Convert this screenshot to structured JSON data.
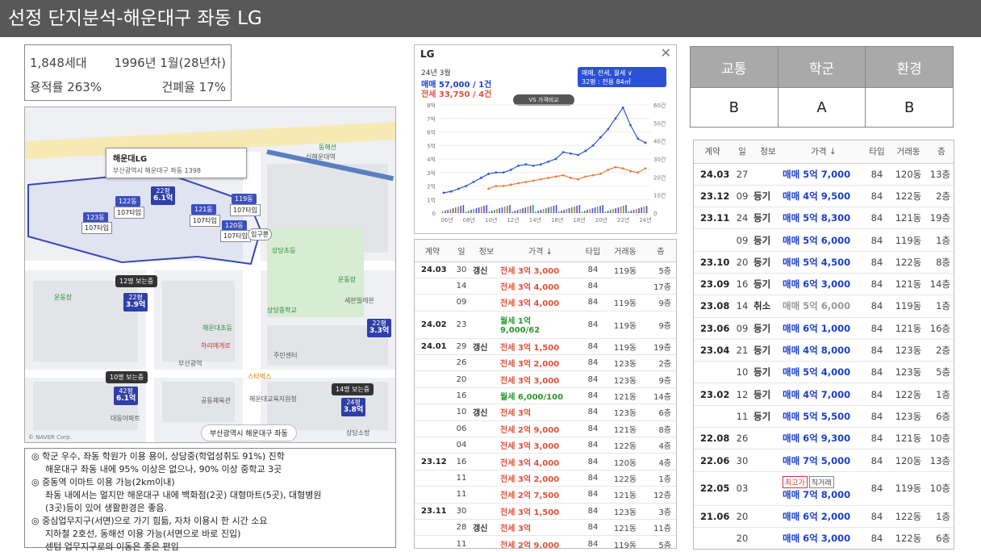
{
  "title": "선정 단지분석-해운대구 좌동 LG",
  "info": {
    "households": "1,848세대",
    "built": "1996년 1월(28년차)",
    "far": "용적률 263%",
    "bcr": "건폐율 17%"
  },
  "map": {
    "popup_name": "해운대LG",
    "popup_addr": "부산광역시 해운대구 좌동 1398",
    "address_bar": "부산광역시 해운대구 좌동",
    "credit": "© NAVER Corp.",
    "station": "신해운대역",
    "entrance": "입구뿐",
    "pins": [
      {
        "label": "22평",
        "price": "6.1억"
      },
      {
        "label": "22평",
        "price": "3.9억"
      },
      {
        "label": "22평",
        "price": "3.3억"
      },
      {
        "label": "42평",
        "price": "6.1억"
      },
      {
        "label": "24평",
        "price": "3.8억"
      }
    ],
    "buildings": [
      {
        "dong": "122동",
        "type": "107타입"
      },
      {
        "dong": "123동",
        "type": "107타입"
      },
      {
        "dong": "121동",
        "type": "107타입"
      },
      {
        "dong": "119동",
        "type": "107타입"
      },
      {
        "dong": "120동",
        "type": "107타입"
      }
    ],
    "floor_tags": [
      "12명 보는중",
      "10명 보는중",
      "14명 보는중"
    ],
    "places": [
      "상당초등",
      "상당중학교",
      "운동장",
      "하리에게로",
      "해운대초등",
      "부산광역",
      "스타벅스",
      "공동체육관",
      "해운대교육지원청",
      "대동아파트",
      "주민센터",
      "세븐일레븐",
      "상당소방",
      "동해선"
    ]
  },
  "notes": [
    "◎ 학군 우수, 좌동 학원가 이용 용이, 상당중(학업성취도 91%) 진학",
    "해운대구 좌동 내에 95% 이상은 없으나, 90% 이상 중학교 3곳",
    "◎ 중동역 이마트 이용 가능(2km이내)",
    "좌동 내에서는 멀지만 해운대구 내에 백화점(2곳) 대형마트(5곳), 대형병원",
    "(3곳)등이 있어 생활환경은 좋음.",
    "◎ 중심업무지구(서면)으로 가기 힘듦, 자차 이용시 한 시간 소요",
    "지하철 2호선, 동해선 이용 가능(서면으로 바로 진입)",
    "센텀 업무지구로의 이동은 좋은 편임"
  ],
  "chart_panel": {
    "title": "LG",
    "period": "24년 3월",
    "sale_summary": "매매 57,000 / 1건",
    "rent_summary": "전세 33,750 / 4건",
    "filter_line1": "매매, 전세, 월세 ∨",
    "filter_line2": "32평 : 전용 84㎡",
    "compare_button": "VS 가격비교"
  },
  "chart_data": {
    "type": "line",
    "x": [
      "06년",
      "08년",
      "10년",
      "12년",
      "14년",
      "16년",
      "18년",
      "20년",
      "22년",
      "24년"
    ],
    "y_left_ticks": [
      "0",
      "1억",
      "2억",
      "3억",
      "4억",
      "5억",
      "6억",
      "7억",
      "8억"
    ],
    "y_right_ticks": [
      "0",
      "10건",
      "20건",
      "30건",
      "40건",
      "50건",
      "60건"
    ],
    "ylim": [
      0,
      8
    ],
    "series": [
      {
        "name": "매매",
        "color": "#2a5ad8",
        "values": [
          1.5,
          1.6,
          1.8,
          2.0,
          2.3,
          2.6,
          2.9,
          3.0,
          3.0,
          3.2,
          3.5,
          3.6,
          3.5,
          3.6,
          3.8,
          4.0,
          4.5,
          4.4,
          4.3,
          4.6,
          5.0,
          5.6,
          6.2,
          7.0,
          7.8,
          6.5,
          5.5,
          5.2
        ]
      },
      {
        "name": "전세",
        "color": "#f07a3a",
        "values": [
          null,
          null,
          null,
          null,
          null,
          null,
          1.8,
          2.0,
          2.0,
          2.1,
          2.2,
          2.3,
          2.4,
          2.5,
          2.6,
          2.7,
          2.8,
          2.6,
          2.5,
          2.7,
          2.8,
          2.9,
          3.2,
          3.4,
          3.3,
          3.1,
          3.0,
          3.3
        ]
      }
    ],
    "grid": true
  },
  "mid_table": {
    "headers": [
      "계약",
      "일",
      "정보",
      "가격 ↓",
      "타입",
      "거래동",
      "층"
    ],
    "rows": [
      {
        "date": "24.03",
        "day": "30",
        "info": "갱신",
        "price": "전세 3억 3,000",
        "type": "84",
        "dong": "119동",
        "floor": "5층",
        "kind": "jeonse"
      },
      {
        "date": "",
        "day": "14",
        "info": "",
        "price": "전세 3억 4,000",
        "type": "84",
        "dong": "",
        "floor": "17층",
        "kind": "jeonse"
      },
      {
        "date": "",
        "day": "09",
        "info": "",
        "price": "전세 3억 4,000",
        "type": "84",
        "dong": "119동",
        "floor": "9층",
        "kind": "jeonse"
      },
      {
        "date": "24.02",
        "day": "23",
        "info": "",
        "price": "월세 1억",
        "price2": "9,000/62",
        "type": "84",
        "dong": "119동",
        "floor": "9층",
        "kind": "wolse"
      },
      {
        "date": "24.01",
        "day": "29",
        "info": "갱신",
        "price": "전세 3억 1,500",
        "type": "84",
        "dong": "119동",
        "floor": "19층",
        "kind": "jeonse"
      },
      {
        "date": "",
        "day": "26",
        "info": "",
        "price": "전세 3억 2,000",
        "type": "84",
        "dong": "123동",
        "floor": "2층",
        "kind": "jeonse"
      },
      {
        "date": "",
        "day": "20",
        "info": "",
        "price": "전세 3억 3,000",
        "type": "84",
        "dong": "123동",
        "floor": "9층",
        "kind": "jeonse"
      },
      {
        "date": "",
        "day": "16",
        "info": "",
        "price": "월세 6,000/100",
        "type": "84",
        "dong": "121동",
        "floor": "14층",
        "kind": "wolse"
      },
      {
        "date": "",
        "day": "10",
        "info": "갱신",
        "price": "전세 3억",
        "type": "84",
        "dong": "123동",
        "floor": "6층",
        "kind": "jeonse"
      },
      {
        "date": "",
        "day": "06",
        "info": "",
        "price": "전세 2억 9,000",
        "type": "84",
        "dong": "121동",
        "floor": "8층",
        "kind": "jeonse"
      },
      {
        "date": "",
        "day": "04",
        "info": "",
        "price": "전세 3억 3,000",
        "type": "84",
        "dong": "122동",
        "floor": "4층",
        "kind": "jeonse"
      },
      {
        "date": "23.12",
        "day": "16",
        "info": "",
        "price": "전세 3억 4,000",
        "type": "84",
        "dong": "120동",
        "floor": "4층",
        "kind": "jeonse"
      },
      {
        "date": "",
        "day": "11",
        "info": "",
        "price": "전세 3억 2,000",
        "type": "84",
        "dong": "122동",
        "floor": "1층",
        "kind": "jeonse"
      },
      {
        "date": "",
        "day": "11",
        "info": "",
        "price": "전세 2억 7,500",
        "type": "84",
        "dong": "121동",
        "floor": "12층",
        "kind": "jeonse"
      },
      {
        "date": "23.11",
        "day": "30",
        "info": "",
        "price": "전세 3억 1,500",
        "type": "84",
        "dong": "123동",
        "floor": "3층",
        "kind": "jeonse"
      },
      {
        "date": "",
        "day": "28",
        "info": "갱신",
        "price": "전세 3억",
        "type": "84",
        "dong": "121동",
        "floor": "11층",
        "kind": "jeonse"
      },
      {
        "date": "",
        "day": "11",
        "info": "",
        "price": "전세 2억 9,000",
        "type": "84",
        "dong": "119동",
        "floor": "5층",
        "kind": "jeonse"
      }
    ]
  },
  "score": {
    "headers": [
      "교통",
      "학군",
      "환경"
    ],
    "values": [
      "B",
      "A",
      "B"
    ]
  },
  "right_table": {
    "headers": [
      "계약",
      "일",
      "정보",
      "가격 ↓",
      "타입",
      "거래동",
      "층"
    ],
    "rows": [
      {
        "date": "24.03",
        "day": "27",
        "info": "",
        "price": "매매 5억 7,000",
        "type": "84",
        "dong": "120동",
        "floor": "13층"
      },
      {
        "date": "23.12",
        "day": "09",
        "info": "등기",
        "price": "매매 4억 9,500",
        "type": "84",
        "dong": "122동",
        "floor": "2층"
      },
      {
        "date": "23.11",
        "day": "24",
        "info": "등기",
        "price": "매매 5억 8,300",
        "type": "84",
        "dong": "121동",
        "floor": "19층"
      },
      {
        "date": "",
        "day": "09",
        "info": "등기",
        "price": "매매 5억 6,000",
        "type": "84",
        "dong": "119동",
        "floor": "1층"
      },
      {
        "date": "23.10",
        "day": "20",
        "info": "등기",
        "price": "매매 5억 4,500",
        "type": "84",
        "dong": "122동",
        "floor": "8층"
      },
      {
        "date": "23.09",
        "day": "16",
        "info": "등기",
        "price": "매매 6억 3,000",
        "type": "84",
        "dong": "121동",
        "floor": "14층"
      },
      {
        "date": "23.08",
        "day": "14",
        "info": "취소",
        "price": "매매 5억 6,000",
        "type": "84",
        "dong": "119동",
        "floor": "1층",
        "muted": true
      },
      {
        "date": "23.06",
        "day": "09",
        "info": "등기",
        "price": "매매 6억 1,000",
        "type": "84",
        "dong": "121동",
        "floor": "16층"
      },
      {
        "date": "23.04",
        "day": "21",
        "info": "등기",
        "price": "매매 4억 8,000",
        "type": "84",
        "dong": "123동",
        "floor": "2층"
      },
      {
        "date": "",
        "day": "10",
        "info": "등기",
        "price": "매매 5억 4,000",
        "type": "84",
        "dong": "123동",
        "floor": "5층"
      },
      {
        "date": "23.02",
        "day": "12",
        "info": "등기",
        "price": "매매 4억 7,000",
        "type": "84",
        "dong": "122동",
        "floor": "1층"
      },
      {
        "date": "",
        "day": "11",
        "info": "등기",
        "price": "매매 5억 5,500",
        "type": "84",
        "dong": "123동",
        "floor": "6층"
      },
      {
        "date": "22.08",
        "day": "26",
        "info": "",
        "price": "매매 6억 9,300",
        "type": "84",
        "dong": "121동",
        "floor": "10층"
      },
      {
        "date": "22.06",
        "day": "30",
        "info": "",
        "price": "매매 7억 5,000",
        "type": "84",
        "dong": "120동",
        "floor": "13층"
      },
      {
        "date": "22.05",
        "day": "03",
        "info": "",
        "price": "매매 7억 8,000",
        "badge1": "최고가",
        "badge2": "직거래",
        "type": "84",
        "dong": "119동",
        "floor": "10층"
      },
      {
        "date": "21.06",
        "day": "20",
        "info": "",
        "price": "매매 6억 2,000",
        "type": "84",
        "dong": "122동",
        "floor": "1층"
      },
      {
        "date": "",
        "day": "20",
        "info": "",
        "price": "매매 6억 3,000",
        "type": "84",
        "dong": "122동",
        "floor": "6층"
      }
    ]
  }
}
